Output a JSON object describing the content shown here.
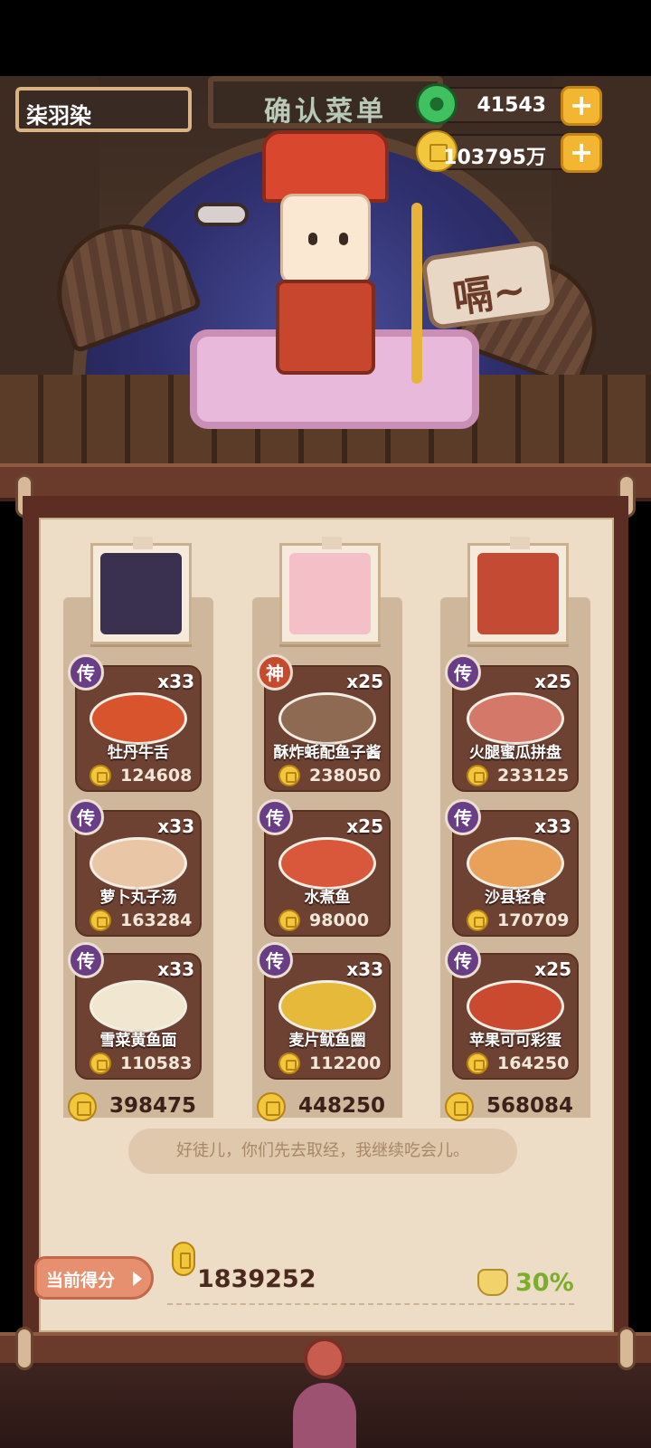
{
  "banner_title": "确认菜单",
  "player": {
    "name": "柒羽染"
  },
  "currencies": [
    {
      "type": "jade",
      "value": "41543",
      "plus": "+"
    },
    {
      "type": "coin",
      "value": "103795万",
      "plus": "+"
    }
  ],
  "speech_bubble": "嗝~",
  "columns": [
    {
      "portrait_color": "#3a3150",
      "dishes": [
        {
          "rank": "传",
          "rank_type": "chuan",
          "count": "x33",
          "name": "牡丹牛舌",
          "price": "124608",
          "color": "#d8542d"
        },
        {
          "rank": "传",
          "rank_type": "chuan",
          "count": "x33",
          "name": "萝卜丸子汤",
          "price": "163284",
          "color": "#e9c7a6"
        },
        {
          "rank": "传",
          "rank_type": "chuan",
          "count": "x33",
          "name": "雪菜黄鱼面",
          "price": "110583",
          "color": "#f1e6cf"
        }
      ],
      "total": "398475"
    },
    {
      "portrait_color": "#f4bfc6",
      "dishes": [
        {
          "rank": "神",
          "rank_type": "shen",
          "count": "x25",
          "name": "酥炸蚝配鱼子酱",
          "price": "238050",
          "color": "#8f6a52"
        },
        {
          "rank": "传",
          "rank_type": "chuan",
          "count": "x25",
          "name": "水煮鱼",
          "price": "98000",
          "color": "#d9573a"
        },
        {
          "rank": "传",
          "rank_type": "chuan",
          "count": "x33",
          "name": "麦片鱿鱼圈",
          "price": "112200",
          "color": "#e6b93a"
        }
      ],
      "total": "448250"
    },
    {
      "portrait_color": "#c44a33",
      "dishes": [
        {
          "rank": "传",
          "rank_type": "chuan",
          "count": "x25",
          "name": "火腿蜜瓜拼盘",
          "price": "233125",
          "color": "#d4786a"
        },
        {
          "rank": "传",
          "rank_type": "chuan",
          "count": "x33",
          "name": "沙县轻食",
          "price": "170709",
          "color": "#e9a15a"
        },
        {
          "rank": "传",
          "rank_type": "chuan",
          "count": "x25",
          "name": "苹果可可彩蛋",
          "price": "164250",
          "color": "#c94a2e"
        }
      ],
      "total": "568084"
    }
  ],
  "quote": "好徒儿，你们先去取经，我继续吃会儿。",
  "score": {
    "label": "当前得分",
    "value": "1839252",
    "bonus": "30%"
  }
}
